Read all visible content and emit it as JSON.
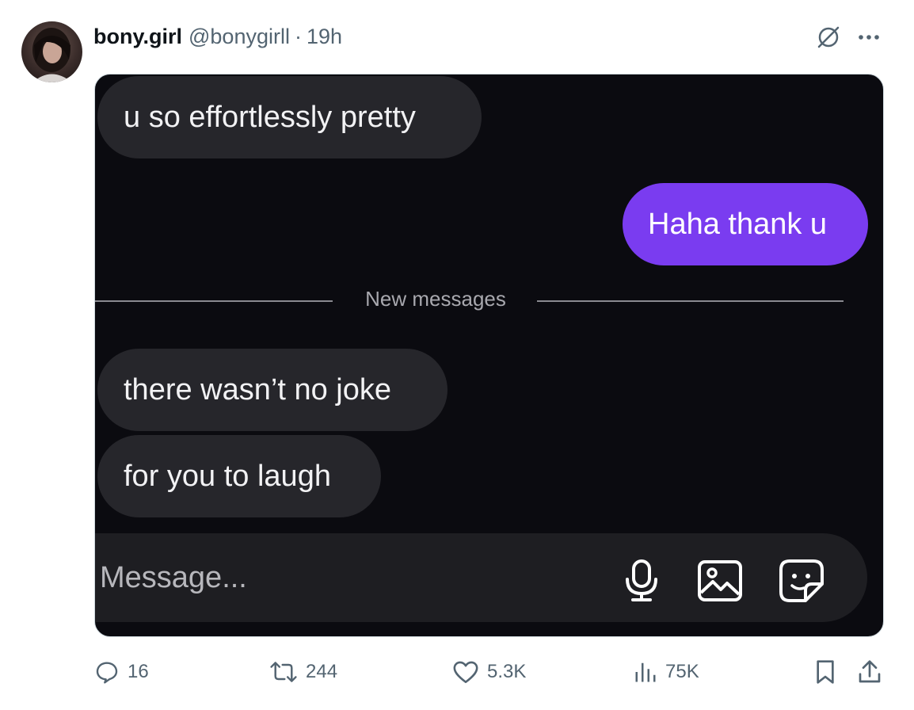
{
  "post": {
    "author_name": "bony.girl",
    "author_handle": "@bonygirll",
    "separator": "·",
    "time": "19h"
  },
  "conversation": {
    "messages": [
      {
        "direction": "received",
        "text": "u so effortlessly pretty"
      },
      {
        "direction": "sent",
        "text": "Haha thank u"
      },
      {
        "direction": "received",
        "text": "there wasn’t no joke"
      },
      {
        "direction": "received",
        "text": "for you to laugh"
      }
    ],
    "divider_label": "New messages",
    "composer_placeholder": "Message...",
    "composer_icons": [
      "microphone-icon",
      "image-icon",
      "sticker-icon"
    ]
  },
  "actions": {
    "replies": "16",
    "reposts": "244",
    "likes": "5.3K",
    "views": "75K"
  },
  "icons": {
    "header": [
      "grok-icon",
      "more-icon"
    ],
    "actions": [
      "reply-icon",
      "repost-icon",
      "like-icon",
      "views-icon",
      "bookmark-icon",
      "share-icon"
    ]
  },
  "colors": {
    "sent_bubble": "#7a3cf0",
    "received_bubble": "#26262b",
    "chat_background": "#0b0b10",
    "meta_text": "#536471"
  }
}
